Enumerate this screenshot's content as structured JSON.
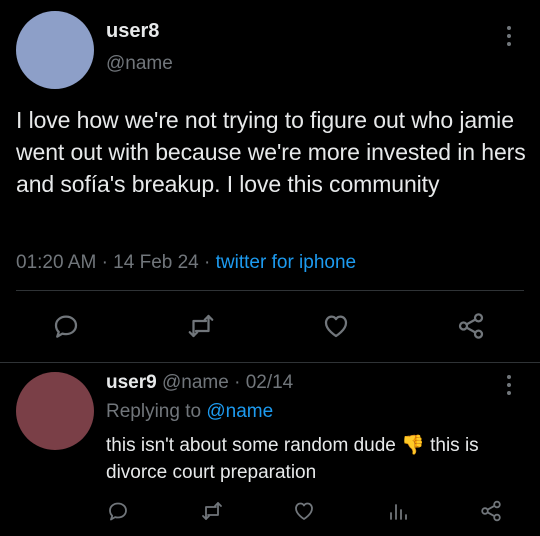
{
  "main_tweet": {
    "avatar_color": "#8d9fc8",
    "username": "user8",
    "handle": "@name",
    "text": "I love how we're not trying to figure out who jamie went out with because we're more invested in hers and sofía's breakup. I love this community",
    "time": "01:20 AM",
    "sep1": "·",
    "date": "14 Feb 24",
    "sep2": "·",
    "source": "twitter for iphone",
    "actions": [
      "reply-icon",
      "retweet-icon",
      "like-icon",
      "share-icon"
    ]
  },
  "reply_tweet": {
    "avatar_color": "#7a3f47",
    "username": "user9",
    "handle": "@name",
    "sep": "·",
    "date": "02/14",
    "replying_prefix": "Replying to",
    "replying_handle": "@name",
    "text_part1": "this isn't about some random dude",
    "emoji": "👎",
    "text_part2": "this is divorce court preparation",
    "actions": [
      "reply-icon",
      "retweet-icon",
      "like-icon",
      "analytics-icon",
      "share-icon"
    ]
  },
  "colors": {
    "background": "#000000",
    "text": "#e7e9ea",
    "muted": "#71767b",
    "link": "#1d9bf0",
    "divider": "#2f3336"
  }
}
